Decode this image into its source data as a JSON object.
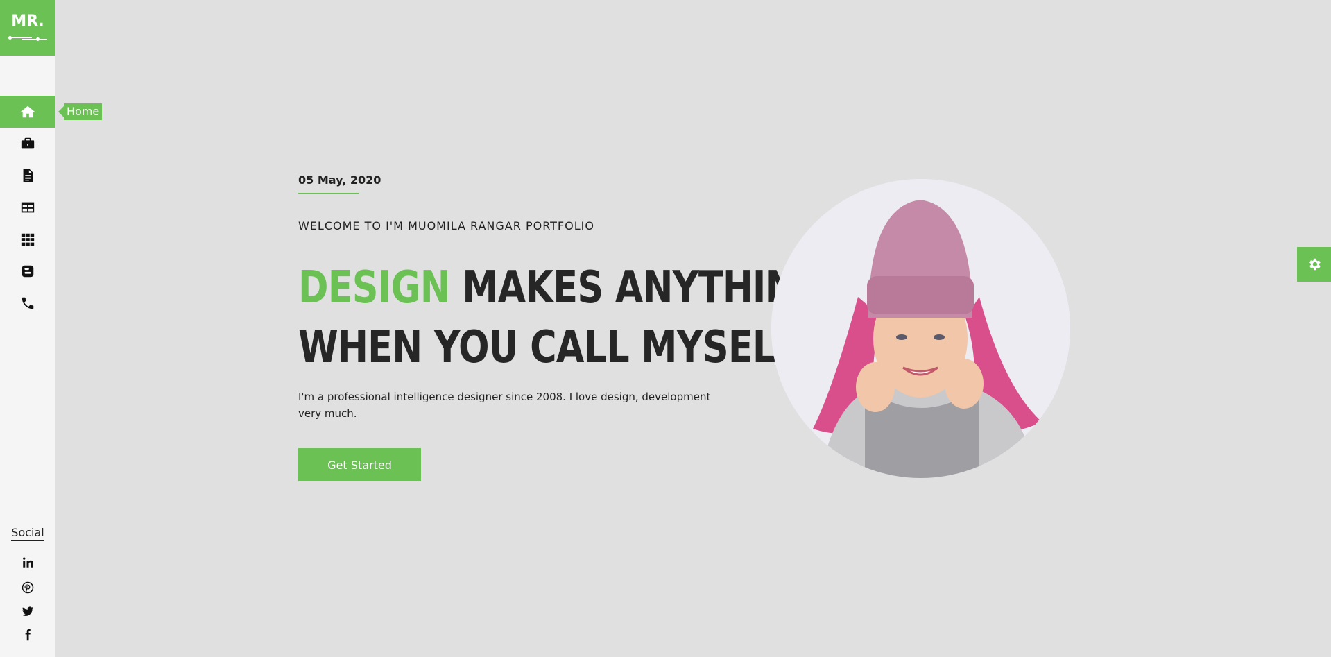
{
  "brand": {
    "logo_text": "MR."
  },
  "sidebar": {
    "items": [
      {
        "icon": "home-icon",
        "label": "Home",
        "active": true
      },
      {
        "icon": "briefcase-icon",
        "active": false
      },
      {
        "icon": "document-icon",
        "active": false
      },
      {
        "icon": "table-icon",
        "active": false
      },
      {
        "icon": "grid-icon",
        "active": false
      },
      {
        "icon": "blogger-icon",
        "active": false
      },
      {
        "icon": "phone-icon",
        "active": false
      }
    ],
    "tooltip": "Home",
    "social_label": "Social",
    "social": [
      {
        "icon": "linkedin-icon"
      },
      {
        "icon": "pinterest-icon"
      },
      {
        "icon": "twitter-icon"
      },
      {
        "icon": "facebook-icon"
      }
    ]
  },
  "hero": {
    "date": "05 May, 2020",
    "welcome": "WELCOME TO I'M MUOMILA RANGAR PORTFOLIO",
    "headline_highlight": "DESIGN",
    "headline_rest_line1": " MAKES ANYTHING",
    "headline_line2": "WHEN YOU CALL MYSELF",
    "description": "I'm a professional intelligence designer since 2008. I love design, development very much.",
    "button_label": "Get Started"
  },
  "colors": {
    "accent": "#6cc155",
    "background": "#e0e0e0",
    "sidebar": "#f5f5f5",
    "text": "#262626"
  },
  "settings": {
    "icon": "gear-icon"
  }
}
